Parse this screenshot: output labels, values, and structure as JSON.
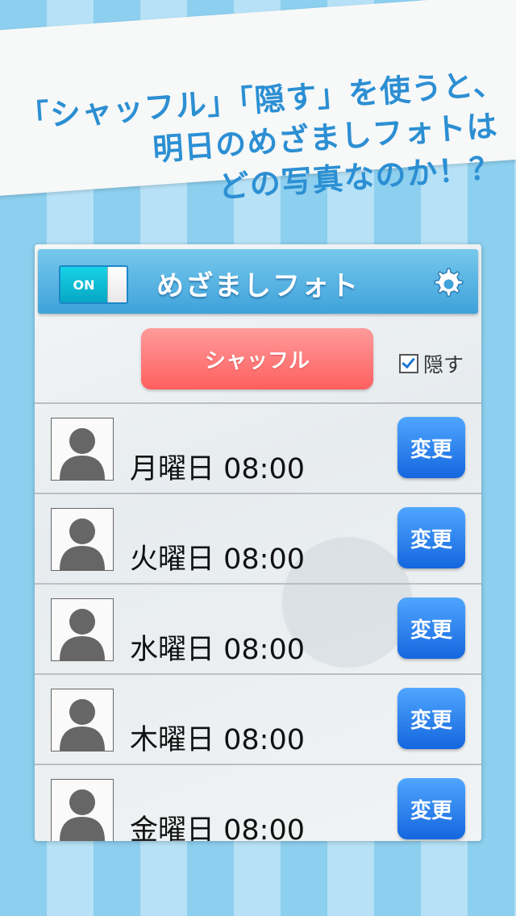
{
  "banner": {
    "line1": "「シャッフル」「隠す」を使うと、",
    "line2": "明日のめざましフォトは",
    "line3": "どの写真なのか！？"
  },
  "navbar": {
    "toggle_label": "ON",
    "title": "めざましフォト",
    "settings_icon": "gear-icon"
  },
  "controls": {
    "shuffle_label": "シャッフル",
    "hide_label": "隠す",
    "hide_checked": true
  },
  "alarms": [
    {
      "label": "月曜日 08:00",
      "button": "変更"
    },
    {
      "label": "火曜日 08:00",
      "button": "変更"
    },
    {
      "label": "水曜日 08:00",
      "button": "変更"
    },
    {
      "label": "木曜日 08:00",
      "button": "変更"
    },
    {
      "label": "金曜日 08:00",
      "button": "変更"
    }
  ],
  "colors": {
    "navbar": "#3fa2da",
    "shuffle": "#ff6b6b",
    "change": "#1d76e6",
    "banner_text": "#2c8fd3"
  }
}
